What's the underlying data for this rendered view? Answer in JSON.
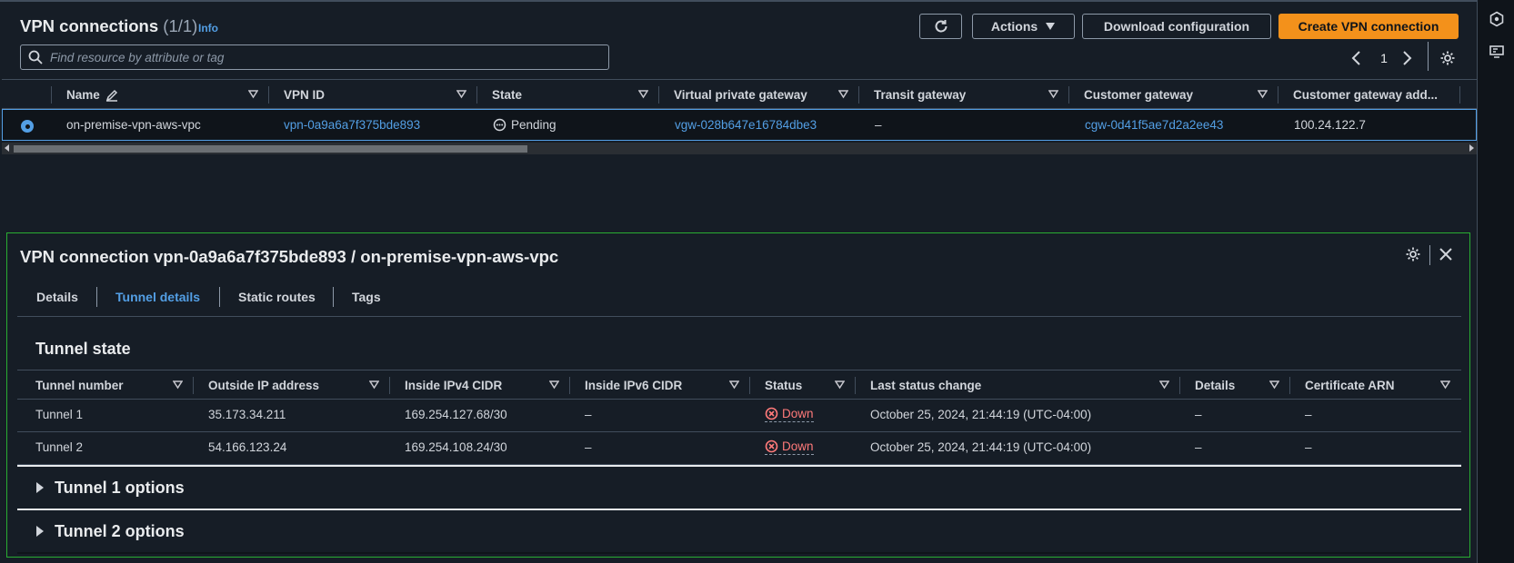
{
  "header": {
    "title": "VPN connections",
    "count": "(1/1)",
    "info": "Info",
    "refresh_icon": "refresh-icon",
    "actions_label": "Actions",
    "download_label": "Download configuration",
    "create_label": "Create VPN connection",
    "accent_color": "#f3911b"
  },
  "search": {
    "placeholder": "Find resource by attribute or tag"
  },
  "pager": {
    "page": "1"
  },
  "vpn_table": {
    "columns": [
      "Name",
      "VPN ID",
      "State",
      "Virtual private gateway",
      "Transit gateway",
      "Customer gateway",
      "Customer gateway add..."
    ],
    "rows": [
      {
        "name": "on-premise-vpn-aws-vpc",
        "vpn_id": "vpn-0a9a6a7f375bde893",
        "state": "Pending",
        "vgw": "vgw-028b647e16784dbe3",
        "tgw": "–",
        "cgw": "cgw-0d41f5ae7d2a2ee43",
        "cgw_addr": "100.24.122.7"
      }
    ]
  },
  "split_panel": {
    "title": "VPN connection vpn-0a9a6a7f375bde893 / on-premise-vpn-aws-vpc",
    "tabs": [
      "Details",
      "Tunnel details",
      "Static routes",
      "Tags"
    ],
    "active_tab": "Tunnel details",
    "tunnel_state_title": "Tunnel state",
    "tunnel_columns": [
      "Tunnel number",
      "Outside IP address",
      "Inside IPv4 CIDR",
      "Inside IPv6 CIDR",
      "Status",
      "Last status change",
      "Details",
      "Certificate ARN"
    ],
    "tunnels": [
      {
        "number": "Tunnel 1",
        "outside_ip": "35.173.34.211",
        "inside_ipv4": "169.254.127.68/30",
        "inside_ipv6": "–",
        "status": "Down",
        "last_change": "October 25, 2024, 21:44:19 (UTC-04:00)",
        "details": "–",
        "cert_arn": "–"
      },
      {
        "number": "Tunnel 2",
        "outside_ip": "54.166.123.24",
        "inside_ipv4": "169.254.108.24/30",
        "inside_ipv6": "–",
        "status": "Down",
        "last_change": "October 25, 2024, 21:44:19 (UTC-04:00)",
        "details": "–",
        "cert_arn": "–"
      }
    ],
    "tunnel1_options": "Tunnel 1 options",
    "tunnel2_options": "Tunnel 2 options",
    "status_down_color": "#ff7a7a"
  }
}
